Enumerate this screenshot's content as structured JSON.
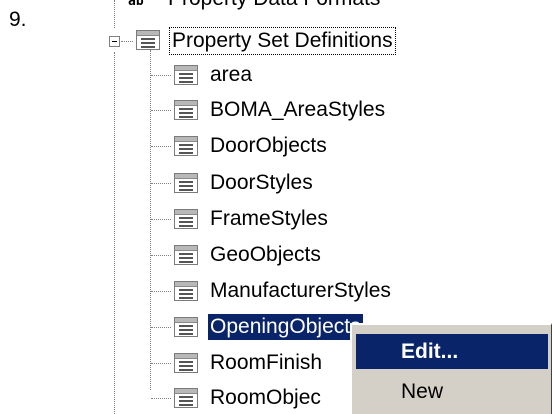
{
  "step_number": "9.",
  "tree": {
    "truncated_top_item": "Property Data Formats",
    "truncated_top_icon": "ab",
    "parent": {
      "label": "Property Set Definitions",
      "icon": "list-icon",
      "expanded": true
    },
    "children": [
      {
        "label": "area"
      },
      {
        "label": "BOMA_AreaStyles"
      },
      {
        "label": "DoorObjects"
      },
      {
        "label": "DoorStyles"
      },
      {
        "label": "FrameStyles"
      },
      {
        "label": "GeoObjects"
      },
      {
        "label": "ManufacturerStyles"
      },
      {
        "label": "OpeningObjects",
        "selected": true
      },
      {
        "label": "RoomFinish"
      },
      {
        "label": "RoomObjec"
      }
    ]
  },
  "context_menu": {
    "items": [
      {
        "label": "Edit...",
        "highlighted": true
      },
      {
        "label": "New",
        "highlighted": false
      }
    ]
  },
  "colors": {
    "selection": "#0a246a",
    "menu_background": "#d4d0c8"
  }
}
